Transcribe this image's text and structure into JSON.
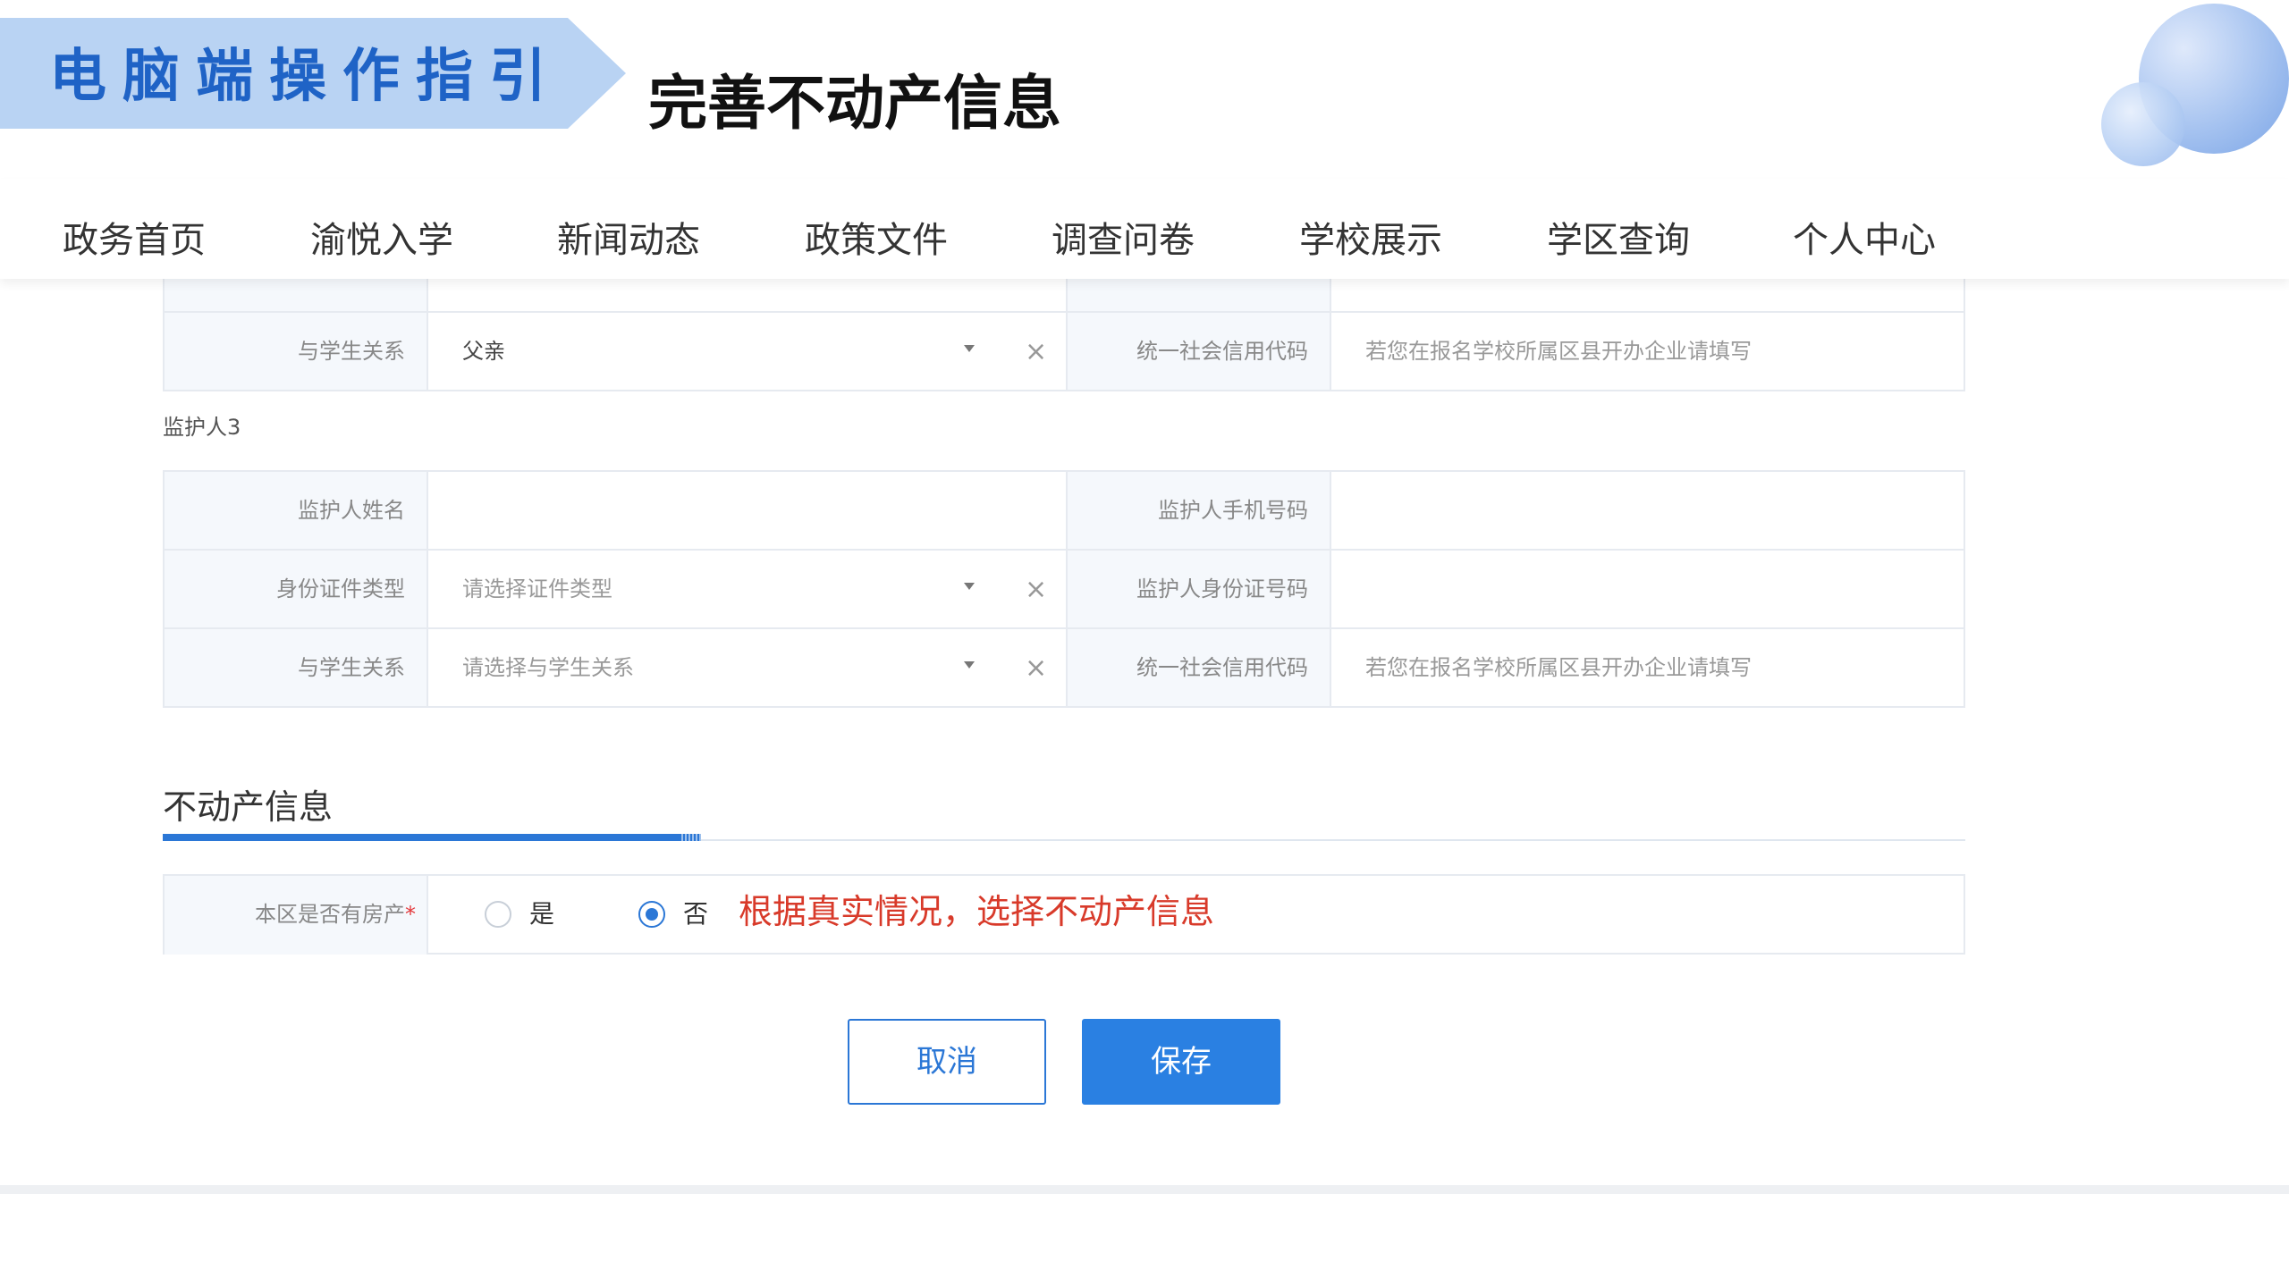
{
  "slide": {
    "banner": "电脑端操作指引",
    "title": "完善不动产信息"
  },
  "nav": {
    "items": [
      "政务首页",
      "渝悦入学",
      "新闻动态",
      "政策文件",
      "调查问卷",
      "学校展示",
      "学区查询",
      "个人中心"
    ]
  },
  "guardian2": {
    "relation_label": "与学生关系",
    "relation_value": "父亲",
    "credit_label": "统一社会信用代码",
    "credit_placeholder": "若您在报名学校所属区县开办企业请填写"
  },
  "guardian3": {
    "heading": "监护人3",
    "name_label": "监护人姓名",
    "phone_label": "监护人手机号码",
    "idtype_label": "身份证件类型",
    "idtype_placeholder": "请选择证件类型",
    "idno_label": "监护人身份证号码",
    "relation_label": "与学生关系",
    "relation_placeholder": "请选择与学生关系",
    "credit_label": "统一社会信用代码",
    "credit_placeholder": "若您在报名学校所属区县开办企业请填写"
  },
  "property": {
    "section_title": "不动产信息",
    "question_label": "本区是否有房产",
    "required_mark": "*",
    "option_yes": "是",
    "option_no": "否",
    "selected": "否",
    "hint": "根据真实情况，选择不动产信息"
  },
  "actions": {
    "cancel_label": "取消",
    "save_label": "保存"
  },
  "colors": {
    "accent": "#2b77d6",
    "banner_bg": "#b9d3f3",
    "hint": "#d83a2a"
  }
}
